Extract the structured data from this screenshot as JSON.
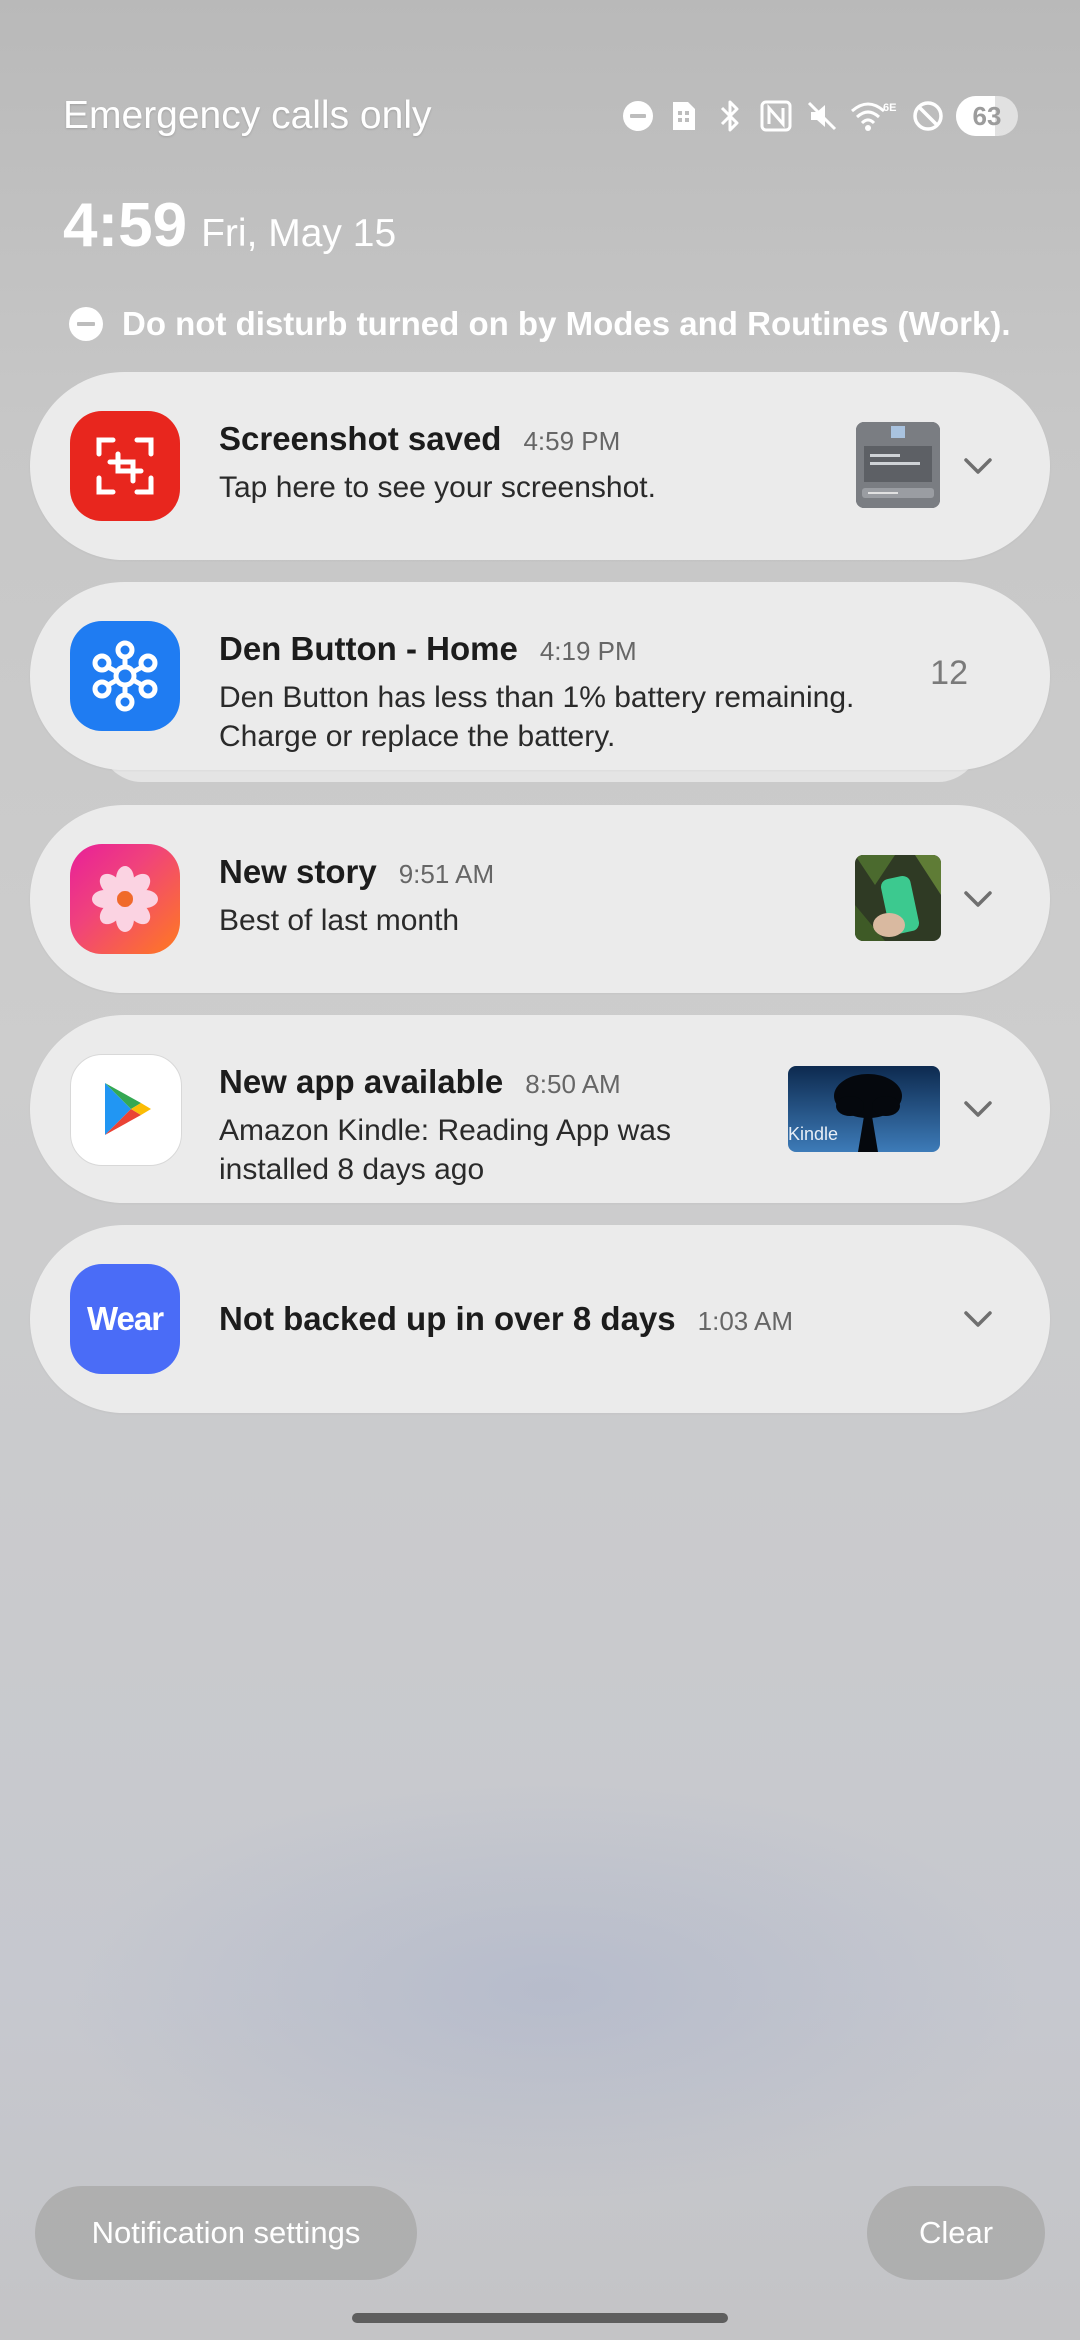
{
  "status_bar": {
    "carrier": "Emergency calls only",
    "icons": [
      "dnd-icon",
      "sim-icon",
      "bluetooth-icon",
      "nfc-icon",
      "mute-icon",
      "wifi-6e-icon",
      "blocked-icon"
    ],
    "wifi_label": "6E",
    "battery": "63",
    "battery_level": 0.63
  },
  "header": {
    "time": "4:59",
    "date": "Fri, May 15",
    "dnd_message": "Do not disturb turned on by Modes and Routines (Work)."
  },
  "notifications": [
    {
      "app_icon": "screenshot-icon",
      "title": "Screenshot saved",
      "time": "4:59 PM",
      "body": "Tap here to see your screenshot.",
      "has_thumbnail": true,
      "expand_icon": "chevron-down-icon"
    },
    {
      "app_icon": "smartthings-icon",
      "title": "Den Button - Home",
      "time": "4:19 PM",
      "body": "Den Button has less than 1% battery remaining. Charge or replace the battery.",
      "count": "12"
    },
    {
      "app_icon": "gallery-icon",
      "title": "New story",
      "time": "9:51 AM",
      "body": "Best of last month",
      "has_thumbnail": true,
      "expand_icon": "chevron-down-icon"
    },
    {
      "app_icon": "play-store-icon",
      "title": "New app available",
      "time": "8:50 AM",
      "body": "Amazon Kindle: Reading App was installed 8 days ago",
      "thumbnail_text": "Kindle",
      "expand_icon": "chevron-down-icon"
    },
    {
      "app_icon": "wear-icon",
      "app_icon_label": "Wear",
      "title": "Not backed up in over 8 days",
      "time": "1:03 AM",
      "expand_icon": "chevron-down-icon"
    }
  ],
  "footer": {
    "settings_label": "Notification settings",
    "clear_label": "Clear"
  },
  "colors": {
    "screenshot_red": "#e8261e",
    "smartthings_blue": "#1f7cf2",
    "wear_blue": "#4a6cf7",
    "card_bg": "#ebebeb"
  }
}
